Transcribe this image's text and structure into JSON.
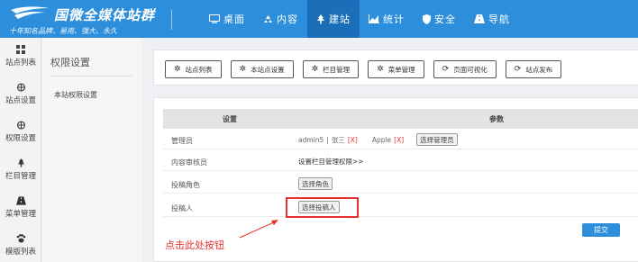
{
  "header": {
    "logo_title": "国微全媒体站群",
    "logo_subtitle": "十年知名品牌、易用、强大、永久",
    "nav": [
      {
        "label": "桌面",
        "icon": "monitor-icon",
        "active": false
      },
      {
        "label": "内容",
        "icon": "recycle-icon",
        "active": false
      },
      {
        "label": "建站",
        "icon": "tree-icon",
        "active": true
      },
      {
        "label": "统计",
        "icon": "chart-icon",
        "active": false
      },
      {
        "label": "安全",
        "icon": "shield-icon",
        "active": false
      },
      {
        "label": "导航",
        "icon": "road-icon",
        "active": false
      }
    ],
    "colors": {
      "bar": "#2d8fdc",
      "active": "#1a6fb8"
    }
  },
  "sidebar": {
    "items": [
      {
        "label": "站点列表",
        "icon": "grid-icon"
      },
      {
        "label": "站点设置",
        "icon": "settings-icon"
      },
      {
        "label": "权限设置",
        "icon": "settings-icon"
      },
      {
        "label": "栏目管理",
        "icon": "tree-icon"
      },
      {
        "label": "菜单管理",
        "icon": "road-icon"
      },
      {
        "label": "模版列表",
        "icon": "paw-icon"
      }
    ]
  },
  "subsidebar": {
    "title": "权限设置",
    "items": [
      "本站权限设置"
    ]
  },
  "toolbar": {
    "buttons": [
      {
        "label": "站点列表",
        "icon": "gear-icon"
      },
      {
        "label": "本站点设置",
        "icon": "gear-icon"
      },
      {
        "label": "栏目管理",
        "icon": "gear-icon"
      },
      {
        "label": "菜单管理",
        "icon": "gear-icon"
      },
      {
        "label": "页面可视化",
        "icon": "refresh-icon"
      },
      {
        "label": "站点发布",
        "icon": "refresh-icon"
      }
    ]
  },
  "table": {
    "headers": {
      "settings": "设置",
      "params": "参数"
    },
    "rows": {
      "admin": {
        "label": "管理员",
        "users": [
          {
            "name": "admin5",
            "sep": " | ",
            "remove": ""
          },
          {
            "name": "张三",
            "sep": "",
            "remove": "[X]"
          },
          {
            "name": "Apple",
            "sep": "",
            "remove": "[X]"
          }
        ],
        "button": "选择管理员"
      },
      "review": {
        "label": "内容审核员",
        "text": "设置栏目管理权限>>"
      },
      "role": {
        "label": "投稿角色",
        "button": "选择角色"
      },
      "contributor": {
        "label": "投稿人",
        "button": "选择投稿人"
      }
    },
    "submit": "提交"
  },
  "annotation": {
    "text": "点击此处按钮",
    "color": "#e63030"
  }
}
